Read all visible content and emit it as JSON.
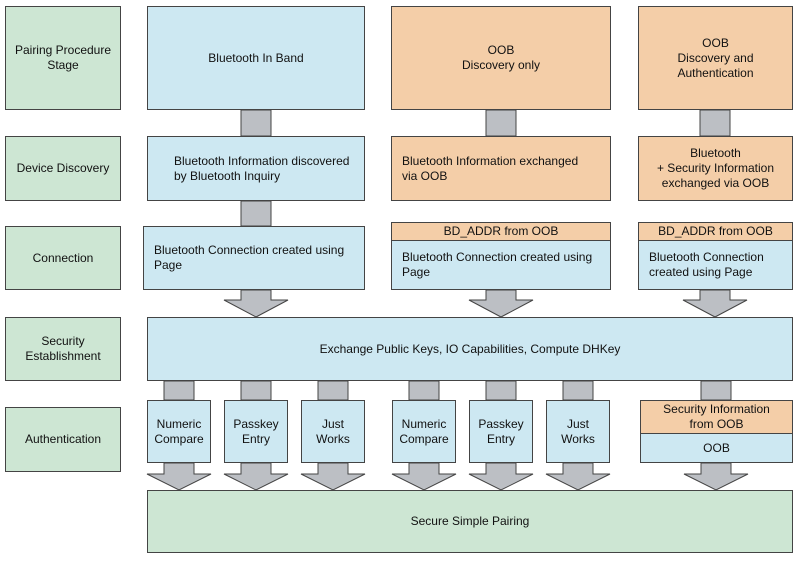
{
  "stages": {
    "pairing": "Pairing Procedure\nStage",
    "discovery": "Device Discovery",
    "connection": "Connection",
    "security": "Security\nEstablishment",
    "authentication": "Authentication"
  },
  "columns": {
    "inband": {
      "title": "Bluetooth In Band",
      "discovery": "Bluetooth Information discovered\nby Bluetooth Inquiry",
      "connection": "Bluetooth Connection created using\nPage"
    },
    "oob_discovery": {
      "title": "OOB\nDiscovery only",
      "discovery": "Bluetooth Information exchanged\nvia OOB",
      "bd_addr": "BD_ADDR from OOB",
      "connection": "Bluetooth Connection created using\nPage"
    },
    "oob_auth": {
      "title": "OOB\nDiscovery and\nAuthentication",
      "discovery": "Bluetooth\n+ Security Information\nexchanged via OOB",
      "bd_addr": "BD_ADDR from OOB",
      "connection": "Bluetooth Connection\ncreated using Page"
    }
  },
  "security_box": "Exchange Public Keys, IO Capabilities, Compute DHKey",
  "auth_methods": [
    "Numeric\nCompare",
    "Passkey\nEntry",
    "Just\nWorks",
    "Numeric\nCompare",
    "Passkey\nEntry",
    "Just\nWorks"
  ],
  "oob_auth": {
    "info": "Security Information\nfrom OOB",
    "label": "OOB"
  },
  "result": "Secure Simple Pairing",
  "colors": {
    "stage": "#cde6d3",
    "bluetooth": "#cde8f2",
    "oob": "#f4cea8",
    "arrow": "#bcbfc4"
  }
}
